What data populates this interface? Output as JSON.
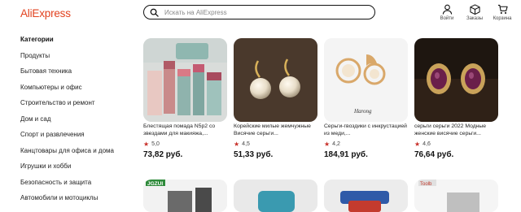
{
  "header": {
    "logo": "AliExpress",
    "search_placeholder": "Искать на AliExpress",
    "icons": [
      {
        "name": "user-icon",
        "label": "Войти"
      },
      {
        "name": "box-icon",
        "label": "Заказы"
      },
      {
        "name": "cart-icon",
        "label": "Корзина"
      }
    ]
  },
  "sidebar": {
    "heading": "Категории",
    "items": [
      "Продукты",
      "Бытовая техника",
      "Компьютеры и офис",
      "Строительство и ремонт",
      "Дом и сад",
      "Спорт и развлечения",
      "Канцтовары для офиса и дома",
      "Игрушки и хобби",
      "Безопасность и защита",
      "Автомобили и мотоциклы"
    ]
  },
  "products": [
    {
      "title": "Блестящая помада N5p2 со звездами для макияжа,...",
      "rating": "5,0",
      "price": "73,82 руб."
    },
    {
      "title": "Корейские милые жемчужные Висячие серьги...",
      "rating": "4,5",
      "price": "51,33 руб."
    },
    {
      "title": "Серьги-гвоздики с инкрустацией из меди,...",
      "rating": "4,2",
      "price": "184,91 руб."
    },
    {
      "title": "серьги серьги 2022 Модные женские висячие серьги...",
      "rating": "4,6",
      "price": "76,64 руб."
    }
  ],
  "product_image_text": {
    "earring_brand": "Harong",
    "jgzui_brand": "JGZUI",
    "toolb_brand": "Toolb"
  },
  "colors": {
    "brand": "#e2421f",
    "star": "#c8312a"
  }
}
